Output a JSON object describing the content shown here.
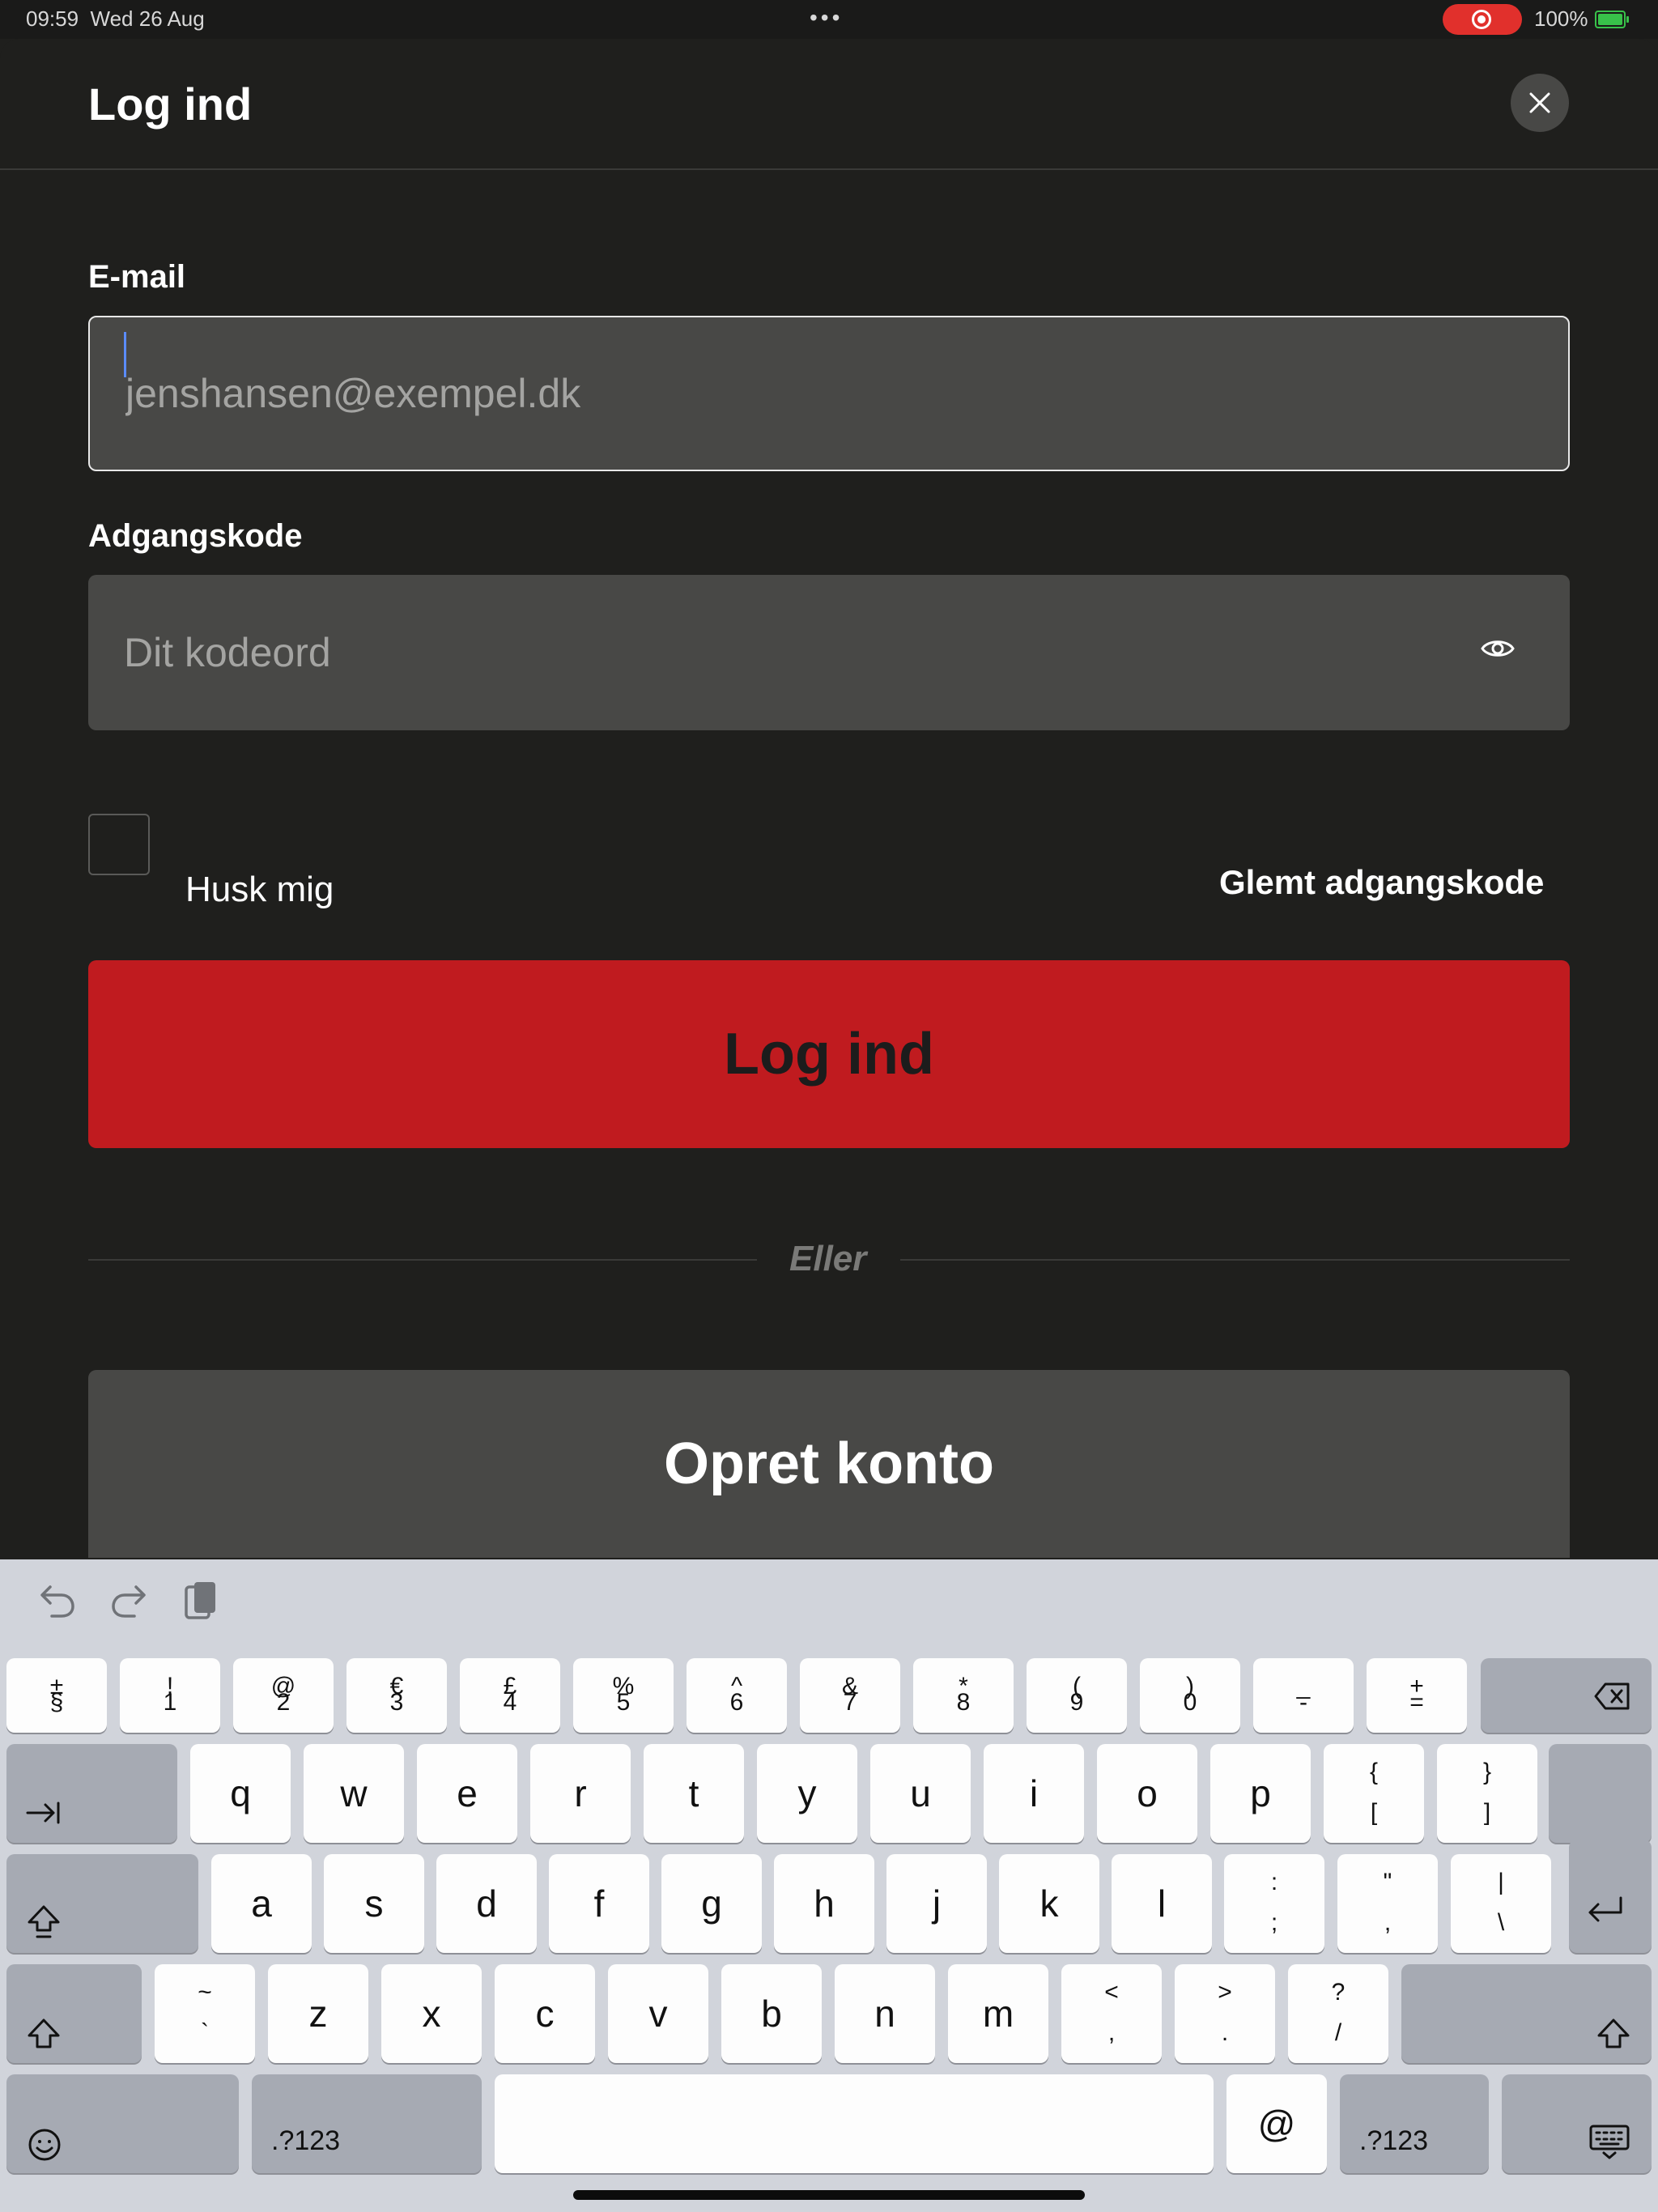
{
  "status_bar": {
    "time": "09:59",
    "date": "Wed 26 Aug",
    "battery": "100%"
  },
  "sheet": {
    "title": "Log ind",
    "email_label": "E-mail",
    "email_placeholder": "jenshansen@exempel.dk",
    "password_label": "Adgangskode",
    "password_placeholder": "Dit kodeord",
    "remember_label": "Husk mig",
    "forgot_label": "Glemt adgangskode",
    "login_label": "Log ind",
    "or_label": "Eller",
    "create_label": "Opret konto"
  },
  "keyboard": {
    "row1": [
      {
        "top": "±",
        "bot": "§"
      },
      {
        "top": "!",
        "bot": "1"
      },
      {
        "top": "@",
        "bot": "2"
      },
      {
        "top": "€",
        "bot": "3"
      },
      {
        "top": "£",
        "bot": "4"
      },
      {
        "top": "%",
        "bot": "5"
      },
      {
        "top": "^",
        "bot": "6"
      },
      {
        "top": "&",
        "bot": "7"
      },
      {
        "top": "*",
        "bot": "8"
      },
      {
        "top": "(",
        "bot": "9"
      },
      {
        "top": ")",
        "bot": "0"
      },
      {
        "top": "_",
        "bot": "-"
      },
      {
        "top": "+",
        "bot": "="
      }
    ],
    "row2": [
      "q",
      "w",
      "e",
      "r",
      "t",
      "y",
      "u",
      "i",
      "o",
      "p"
    ],
    "row2_extra": [
      {
        "top": "{",
        "bot": "["
      },
      {
        "top": "}",
        "bot": "]"
      }
    ],
    "row3": [
      "a",
      "s",
      "d",
      "f",
      "g",
      "h",
      "j",
      "k",
      "l"
    ],
    "row3_extra": [
      {
        "top": ":",
        "bot": ";"
      },
      {
        "top": "\"",
        "bot": ","
      },
      {
        "top": "|",
        "bot": "\\"
      }
    ],
    "row4_first": {
      "top": "~",
      "bot": "`"
    },
    "row4": [
      "z",
      "x",
      "c",
      "v",
      "b",
      "n",
      "m"
    ],
    "row4_extra": [
      {
        "top": "<",
        "bot": ","
      },
      {
        "top": ">",
        "bot": "."
      },
      {
        "top": "?",
        "bot": "/"
      }
    ],
    "numbers_label": ".?123",
    "at_label": "@"
  },
  "icons": {
    "close": "close-icon",
    "eye": "eye-icon",
    "undo": "undo-icon",
    "redo": "redo-icon",
    "paste": "paste-icon",
    "delete": "backspace-icon",
    "tab": "tab-icon",
    "caps": "caps-lock-icon",
    "shift": "shift-icon",
    "return": "return-icon",
    "emoji": "emoji-icon",
    "hide": "keyboard-dismiss-icon"
  },
  "colors": {
    "background": "#1f1f1d",
    "field": "#484846",
    "primary_button": "#c01b1f",
    "keyboard": "#d1d4db"
  }
}
